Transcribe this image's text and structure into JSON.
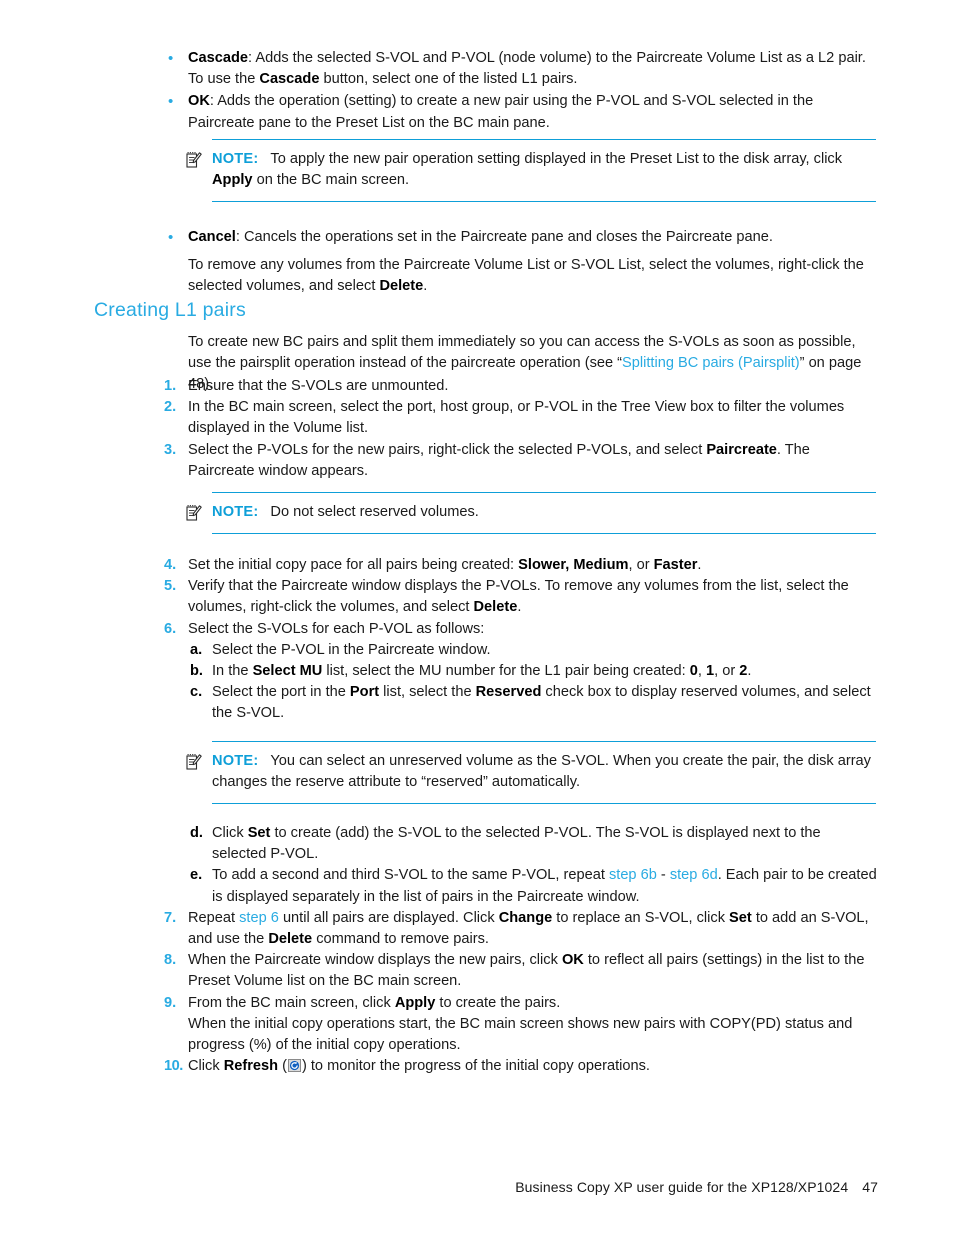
{
  "page": {
    "accent_blue": "#29abe2",
    "rule_blue": "#0e9fd8",
    "body_color": "#1a1a1a"
  },
  "top_bullets": [
    {
      "marker": "•",
      "term": "Cascade",
      "text_after_term": ": Adds the selected S-VOL and P-VOL (node volume) to the Paircreate Volume List as a L2 pair. To use the ",
      "bold_mid": "Cascade",
      "text_end": " button, select one of the listed L1 pairs."
    },
    {
      "marker": "•",
      "term": "OK",
      "text_after_term": ": Adds the operation (setting) to create a new pair using the P-VOL and S-VOL selected in the Paircreate pane to the Preset List on the BC main pane.",
      "bold_mid": "",
      "text_end": ""
    }
  ],
  "note_apply": {
    "icon": "notepad-pencil-icon",
    "label": "NOTE:",
    "text_before_bold": "To apply the new pair operation setting displayed in the Preset List to the disk array, click ",
    "bold": "Apply",
    "text_after_bold": " on the BC main screen."
  },
  "cancel_bullet": {
    "marker": "•",
    "term": "Cancel",
    "text": ": Cancels the operations set in the Paircreate pane and closes the Paircreate pane."
  },
  "remove_para": {
    "text_before_bold": "To remove any volumes from the Paircreate Volume List or S-VOL List, select the volumes, right-click the selected volumes, and select ",
    "bold": "Delete",
    "text_after_bold": "."
  },
  "heading": {
    "title": "Creating L1 pairs"
  },
  "intro_para": {
    "text_before_link": "To create new BC pairs and split them immediately so you can access the S-VOLs as soon as possible, use the pairsplit operation instead of the paircreate operation (see “",
    "link": "Splitting BC pairs (Pairsplit)",
    "text_after_link": "” on page 48)."
  },
  "steps": [
    {
      "num": "1.",
      "parts": [
        {
          "t": "text",
          "v": "Ensure that the S-VOLs are unmounted."
        }
      ]
    },
    {
      "num": "2.",
      "parts": [
        {
          "t": "text",
          "v": "In the BC main screen, select the port, host group, or P-VOL in the Tree View box to filter the volumes displayed in the Volume list."
        }
      ]
    },
    {
      "num": "3.",
      "parts": [
        {
          "t": "text",
          "v": "Select the P-VOLs for the new pairs, right-click the selected P-VOLs, and select "
        },
        {
          "t": "bold",
          "v": "Paircreate"
        },
        {
          "t": "text",
          "v": ". The Paircreate window appears."
        }
      ]
    }
  ],
  "note_reserved": {
    "icon": "notepad-pencil-icon",
    "label": "NOTE:",
    "text": "Do not select reserved volumes."
  },
  "steps2": [
    {
      "num": "4.",
      "parts": [
        {
          "t": "text",
          "v": "Set the initial copy pace for all pairs being created: "
        },
        {
          "t": "bold",
          "v": "Slower, Medium"
        },
        {
          "t": "text",
          "v": ", or "
        },
        {
          "t": "bold",
          "v": "Faster"
        },
        {
          "t": "text",
          "v": "."
        }
      ]
    },
    {
      "num": "5.",
      "parts": [
        {
          "t": "text",
          "v": "Verify that the Paircreate window displays the P-VOLs. To remove any volumes from the list, select the volumes, right-click the volumes, and select "
        },
        {
          "t": "bold",
          "v": "Delete"
        },
        {
          "t": "text",
          "v": "."
        }
      ]
    },
    {
      "num": "6.",
      "parts": [
        {
          "t": "text",
          "v": "Select the S-VOLs for each P-VOL as follows:"
        }
      ]
    }
  ],
  "substeps_abc": [
    {
      "mark": "a.",
      "parts": [
        {
          "t": "text",
          "v": "Select the P-VOL in the Paircreate window."
        }
      ]
    },
    {
      "mark": "b.",
      "parts": [
        {
          "t": "text",
          "v": "In the "
        },
        {
          "t": "bold",
          "v": "Select MU"
        },
        {
          "t": "text",
          "v": " list, select the MU number for the L1 pair being created: "
        },
        {
          "t": "bold",
          "v": "0"
        },
        {
          "t": "text",
          "v": ", "
        },
        {
          "t": "bold",
          "v": "1"
        },
        {
          "t": "text",
          "v": ", or "
        },
        {
          "t": "bold",
          "v": "2"
        },
        {
          "t": "text",
          "v": "."
        }
      ]
    },
    {
      "mark": "c.",
      "parts": [
        {
          "t": "text",
          "v": "Select the port in the "
        },
        {
          "t": "bold",
          "v": "Port"
        },
        {
          "t": "text",
          "v": " list, select the "
        },
        {
          "t": "bold",
          "v": "Reserved"
        },
        {
          "t": "text",
          "v": " check box to display reserved volumes, and select the S-VOL."
        }
      ]
    }
  ],
  "note_unreserved": {
    "icon": "notepad-pencil-icon",
    "label": "NOTE:",
    "text": "You can select an unreserved volume as the S-VOL. When you create the pair, the disk array changes the reserve attribute to “reserved” automatically."
  },
  "substeps_de": [
    {
      "mark": "d.",
      "parts": [
        {
          "t": "text",
          "v": "Click "
        },
        {
          "t": "bold",
          "v": "Set"
        },
        {
          "t": "text",
          "v": " to create (add) the S-VOL to the selected P-VOL. The S-VOL is displayed next to the selected P-VOL."
        }
      ]
    },
    {
      "mark": "e.",
      "parts": [
        {
          "t": "text",
          "v": "To add a second and third S-VOL to the same P-VOL, repeat "
        },
        {
          "t": "link",
          "v": "step 6b"
        },
        {
          "t": "text",
          "v": " - "
        },
        {
          "t": "link",
          "v": "step 6d"
        },
        {
          "t": "text",
          "v": ". Each pair to be created is displayed separately in the list of pairs in the Paircreate window."
        }
      ]
    }
  ],
  "steps3": [
    {
      "num": "7.",
      "parts": [
        {
          "t": "text",
          "v": "Repeat "
        },
        {
          "t": "link",
          "v": "step 6"
        },
        {
          "t": "text",
          "v": " until all pairs are displayed. Click "
        },
        {
          "t": "bold",
          "v": "Change"
        },
        {
          "t": "text",
          "v": " to replace an S-VOL, click "
        },
        {
          "t": "bold",
          "v": "Set"
        },
        {
          "t": "text",
          "v": " to add an S-VOL, and use the "
        },
        {
          "t": "bold",
          "v": "Delete"
        },
        {
          "t": "text",
          "v": " command to remove pairs."
        }
      ]
    },
    {
      "num": "8.",
      "parts": [
        {
          "t": "text",
          "v": "When the Paircreate window displays the new pairs, click "
        },
        {
          "t": "bold",
          "v": "OK"
        },
        {
          "t": "text",
          "v": " to reflect all pairs (settings) in the list to the Preset Volume list on the BC main screen."
        }
      ]
    },
    {
      "num": "9.",
      "parts": [
        {
          "t": "text",
          "v": "From the BC main screen, click "
        },
        {
          "t": "bold",
          "v": "Apply"
        },
        {
          "t": "text",
          "v": " to create the pairs."
        }
      ]
    }
  ],
  "copy_para": {
    "text": "When the initial copy operations start, the BC main screen shows new pairs with COPY(PD) status and progress (%) of the initial copy operations."
  },
  "step10": {
    "num": "10.",
    "text_before": "Click ",
    "bold": "Refresh",
    "text_mid": " (",
    "icon": "refresh-icon",
    "text_after": ") to monitor the progress of the initial copy operations."
  },
  "footer": {
    "text": "Business Copy XP user guide for the XP128/XP1024",
    "page_number": "47"
  }
}
